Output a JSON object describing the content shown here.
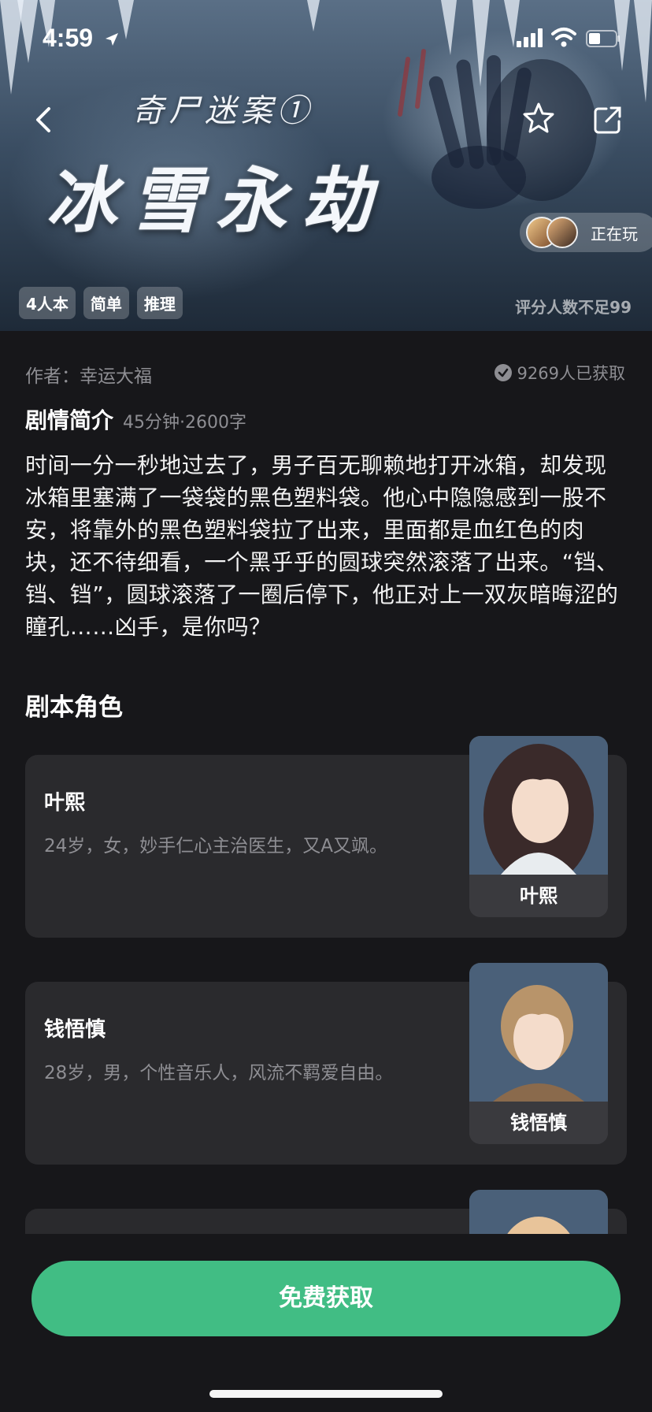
{
  "status_bar": {
    "time": "4:59"
  },
  "hero": {
    "series_title": "奇尸迷案①",
    "main_title": "冰雪永劫",
    "playing_label": "正在玩",
    "tags": [
      "4人本",
      "简单",
      "推理"
    ],
    "rating_note": "评分人数不足99"
  },
  "info": {
    "author": "作者：幸运大福",
    "obtained": "9269人已获取"
  },
  "synopsis": {
    "title": "剧情简介",
    "meta": "45分钟·2600字",
    "body": "时间一分一秒地过去了，男子百无聊赖地打开冰箱，却发现冰箱里塞满了一袋袋的黑色塑料袋。他心中隐隐感到一股不安，将靠外的黑色塑料袋拉了出来，里面都是血红色的肉块，还不待细看，一个黑乎乎的圆球突然滚落了出来。“铛、铛、铛”，圆球滚落了一圈后停下，他正对上一双灰暗晦涩的瞳孔……凶手，是你吗？"
  },
  "roles": {
    "title": "剧本角色",
    "items": [
      {
        "name": "叶熙",
        "desc": "24岁，女，妙手仁心主治医生，又A又飒。",
        "portrait_label": "叶熙"
      },
      {
        "name": "钱悟慎",
        "desc": "28岁，男，个性音乐人，风流不羁爱自由。",
        "portrait_label": "钱悟慎"
      },
      {
        "name": "",
        "desc": "",
        "portrait_label": ""
      }
    ]
  },
  "cta": {
    "label": "免费获取"
  },
  "colors": {
    "accent": "#41bd84",
    "background": "#17171a",
    "card": "#2a2a2d"
  }
}
